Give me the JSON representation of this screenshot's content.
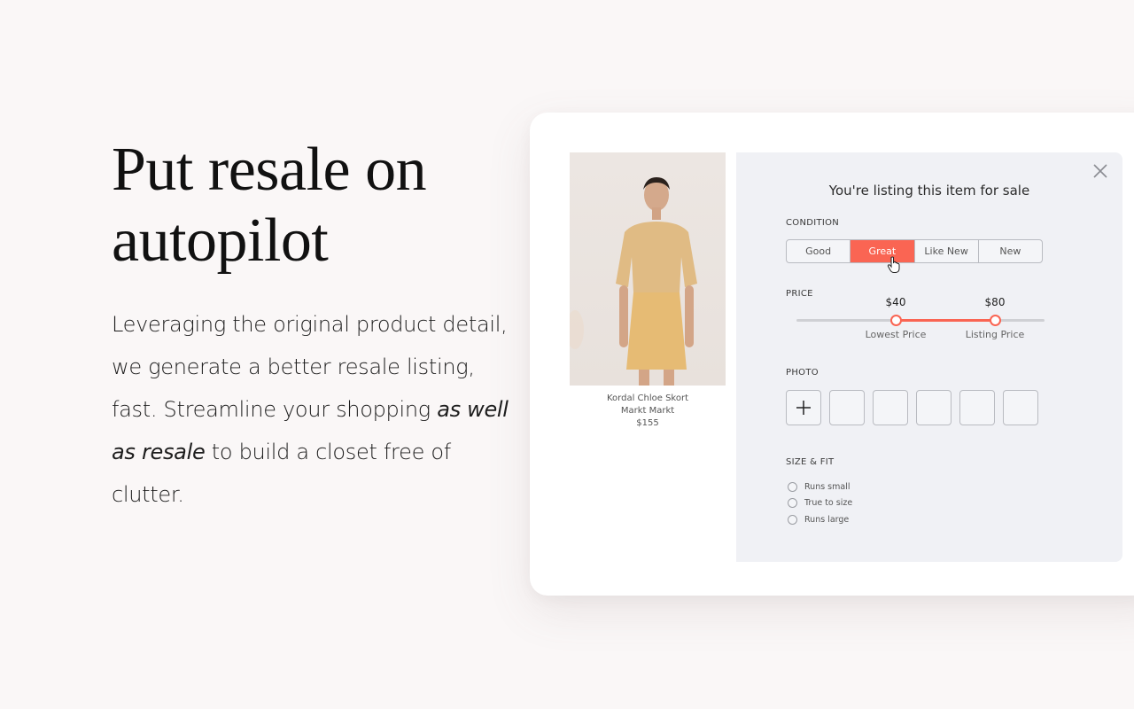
{
  "hero": {
    "title_line1": "Put resale on",
    "title_line2": "autopilot",
    "body_part1": "Leveraging the original product detail, we generate a better resale listing, fast. Streamline your shopping ",
    "body_italic": "as well as resale",
    "body_part2": " to build a closet free of clutter."
  },
  "product": {
    "image_icon": "product-photo-woman-in-yellow-outfit",
    "name": "Kordal Chloe Skort",
    "brand": "Markt Markt",
    "price": "$155"
  },
  "listing_panel": {
    "title": "You're listing this item for sale",
    "close_icon": "close-icon",
    "condition": {
      "label": "CONDITION",
      "options": [
        "Good",
        "Great",
        "Like New",
        "New"
      ],
      "selected": "Great"
    },
    "price": {
      "label": "PRICE",
      "range_min_value": 0,
      "range_max_value": 100,
      "low": {
        "value": "$40",
        "caption": "Lowest Price",
        "amount": 40
      },
      "high": {
        "value": "$80",
        "caption": "Listing Price",
        "amount": 80
      }
    },
    "photo": {
      "label": "PHOTO",
      "add_icon": "plus-icon",
      "empty_slots": 5
    },
    "size_fit": {
      "label": "SIZE & FIT",
      "options": [
        "Runs small",
        "True to size",
        "Runs large"
      ]
    }
  },
  "colors": {
    "accent": "#fa6553",
    "page_bg": "#faf7f7",
    "panel_bg": "#f0f1f5"
  }
}
